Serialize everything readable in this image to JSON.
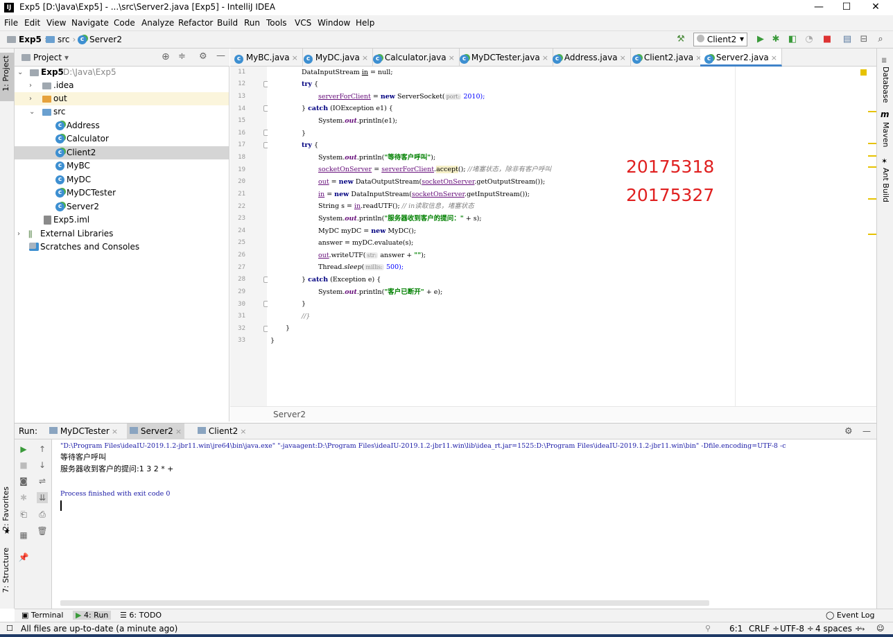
{
  "window": {
    "title": "Exp5 [D:\\Java\\Exp5] - ...\\src\\Server2.java [Exp5] - IntelliJ IDEA",
    "app_icon": "IJ",
    "minimize": "—",
    "maximize": "☐",
    "close": "✕"
  },
  "menu": [
    "File",
    "Edit",
    "View",
    "Navigate",
    "Code",
    "Analyze",
    "Refactor",
    "Build",
    "Run",
    "Tools",
    "VCS",
    "Window",
    "Help"
  ],
  "navbar": {
    "crumbs": [
      "Exp5",
      "src",
      "Server2"
    ],
    "run_config": "Client2",
    "run_config_arrow": "▾"
  },
  "left_strip": {
    "project_tab": "1: Project",
    "favorites_tab": "2: Favorites",
    "structure_tab": "7: Structure"
  },
  "right_strip": {
    "database_tab": "Database",
    "maven_tab": "Maven",
    "ant_tab": "Ant Build"
  },
  "project_panel": {
    "header": "Project",
    "header_arrow": "▾",
    "tree": [
      {
        "label": "Exp5",
        "hint": "D:\\Java\\Exp5",
        "arrow": "⌄",
        "icon": "folder-gray",
        "bold": true
      },
      {
        "label": ".idea",
        "arrow": "›",
        "icon": "folder-gray"
      },
      {
        "label": "out",
        "arrow": "›",
        "icon": "folder-orange"
      },
      {
        "label": "src",
        "arrow": "⌄",
        "icon": "folder-blue"
      },
      {
        "label": "Address",
        "icon": "class-run"
      },
      {
        "label": "Calculator",
        "icon": "class-run"
      },
      {
        "label": "Client2",
        "icon": "class-run",
        "selected": true
      },
      {
        "label": "MyBC",
        "icon": "class"
      },
      {
        "label": "MyDC",
        "icon": "class"
      },
      {
        "label": "MyDCTester",
        "icon": "class-run"
      },
      {
        "label": "Server2",
        "icon": "class-run"
      },
      {
        "label": "Exp5.iml",
        "icon": "iml-file"
      },
      {
        "label": "External Libraries",
        "arrow": "›",
        "icon": "libraries"
      },
      {
        "label": "Scratches and Consoles",
        "icon": "scratches"
      }
    ]
  },
  "editor_tabs": [
    {
      "label": "MyBC.java"
    },
    {
      "label": "MyDC.java"
    },
    {
      "label": "Calculator.java"
    },
    {
      "label": "MyDCTester.java"
    },
    {
      "label": "Address.java"
    },
    {
      "label": "Client2.java"
    },
    {
      "label": "Server2.java",
      "active": true
    }
  ],
  "editor": {
    "line_numbers": [
      "11",
      "12",
      "13",
      "14",
      "15",
      "16",
      "17",
      "18",
      "19",
      "20",
      "21",
      "22",
      "23",
      "24",
      "25",
      "26",
      "27",
      "28",
      "29",
      "30",
      "31",
      "32",
      "33"
    ],
    "breadcrumb": "Server2",
    "annotations": [
      "20175318",
      "20175327"
    ],
    "code": {
      "l11": "DataInputStream ",
      "l11b": "in",
      "l11c": " = null;",
      "l12": "try",
      "l12b": " {",
      "l13a": "serverForClient",
      "l13b": " = ",
      "l13c": "new",
      "l13d": " ServerSocket(",
      "l13e": "port:",
      "l13f": " 2010);",
      "l14a": "} ",
      "l14b": "catch",
      "l14c": " (IOException e1) {",
      "l15a": "System.",
      "l15b": "out",
      "l15c": ".println(e1);",
      "l16": "}",
      "l17": "try",
      "l17b": " {",
      "l18a": "System.",
      "l18b": "out",
      "l18c": ".println(",
      "l18d": "\"等待客户呼叫\"",
      "l18e": ");",
      "l19a": "socketOnServer",
      "l19b": " = ",
      "l19c": "serverForClient",
      "l19d": ".",
      "l19e": "accept",
      "l19f": "(); ",
      "l19g": "//堵塞状态，除非有客户呼叫",
      "l20a": "out",
      "l20b": " = ",
      "l20c": "new",
      "l20d": " DataOutputStream(",
      "l20e": "socketOnServer",
      "l20f": ".getOutputStream());",
      "l21a": "in",
      "l21b": " = ",
      "l21c": "new",
      "l21d": " DataInputStream(",
      "l21e": "socketOnServer",
      "l21f": ".getInputStream());",
      "l22a": "String s = ",
      "l22b": "in",
      "l22c": ".readUTF(); ",
      "l22d": "// in读取信息，堵塞状态",
      "l23a": "System.",
      "l23b": "out",
      "l23c": ".println(",
      "l23d": "\"服务器收到客户的提问：\"",
      "l23e": " + s);",
      "l24a": "MyDC myDC = ",
      "l24b": "new",
      "l24c": " MyDC();",
      "l25": "answer = myDC.evaluate(s);",
      "l26a": "out",
      "l26b": ".writeUTF(",
      "l26c": "str:",
      "l26d": " answer + ",
      "l26e": "\"\"",
      "l26f": ");",
      "l27a": "Thread.",
      "l27b": "sleep",
      "l27c": "(",
      "l27d": "millis:",
      "l27e": " 500);",
      "l28a": "} ",
      "l28b": "catch",
      "l28c": " (Exception e) {",
      "l29a": "System.",
      "l29b": "out",
      "l29c": ".println(",
      "l29d": "\"客户已断开\"",
      "l29e": " + e);",
      "l30": "}",
      "l31": "//}",
      "l32": "}",
      "l33": "}"
    }
  },
  "run_panel": {
    "label": "Run:",
    "tabs": [
      {
        "label": "MyDCTester"
      },
      {
        "label": "Server2",
        "active": true
      },
      {
        "label": "Client2"
      }
    ],
    "settings_icon": "⚙",
    "hide_icon": "—",
    "console": {
      "cmd": "\"D:\\Program Files\\ideaIU-2019.1.2-jbr11.win\\jre64\\bin\\java.exe\" \"-javaagent:D:\\Program Files\\ideaIU-2019.1.2-jbr11.win\\lib\\idea_rt.jar=1525:D:\\Program Files\\ideaIU-2019.1.2-jbr11.win\\bin\" -Dfile.encoding=UTF-8 -c",
      "line1": "等待客户呼叫",
      "line2": "服务器收到客户的提问:1 3 2 * +",
      "line3": "Process finished with exit code 0"
    }
  },
  "bottom_tabs": [
    {
      "label": "Terminal",
      "icon": "terminal-icon"
    },
    {
      "label": "4: Run",
      "icon": "run-icon",
      "active": true
    },
    {
      "label": "6: TODO",
      "icon": "todo-icon"
    }
  ],
  "event_log": "Event Log",
  "status": {
    "message": "All files are up-to-date (a minute ago)",
    "position": "6:1",
    "line_sep": "CRLF ÷",
    "encoding": "UTF-8 ÷",
    "indent": "4 spaces ÷"
  },
  "colors": {
    "keyword": "#000080",
    "string": "#008000",
    "field": "#660e7a",
    "annotation_red": "#e02020",
    "active_tab_underline": "#4083c9",
    "selection": "#d5d5d5"
  }
}
